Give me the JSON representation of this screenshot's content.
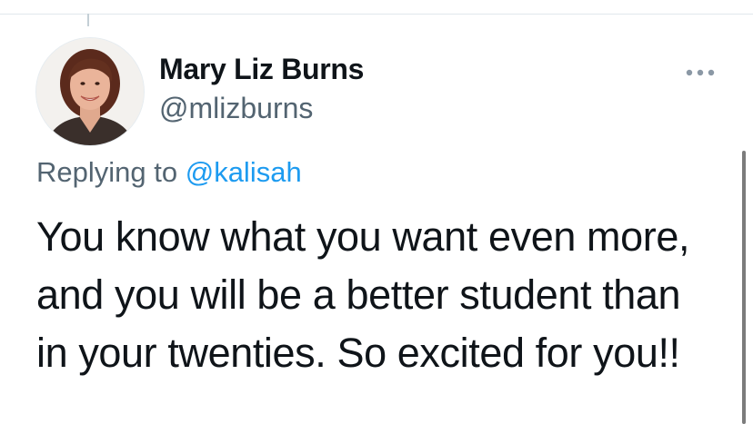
{
  "author": {
    "display_name": "Mary Liz Burns",
    "handle": "@mlizburns",
    "avatar_icon": "profile-photo"
  },
  "reply": {
    "prefix": "Replying to",
    "mention": "@kalisah"
  },
  "tweet": {
    "lines": [
      "You know what you want even more,",
      "and you will be a better student than",
      "in your twenties. So excited for you!!"
    ]
  },
  "icons": {
    "more": "more-options-icon"
  },
  "colors": {
    "text_primary": "#0f1419",
    "text_secondary": "#536471",
    "link": "#1d9bf0",
    "divider": "#e1e8ed"
  }
}
